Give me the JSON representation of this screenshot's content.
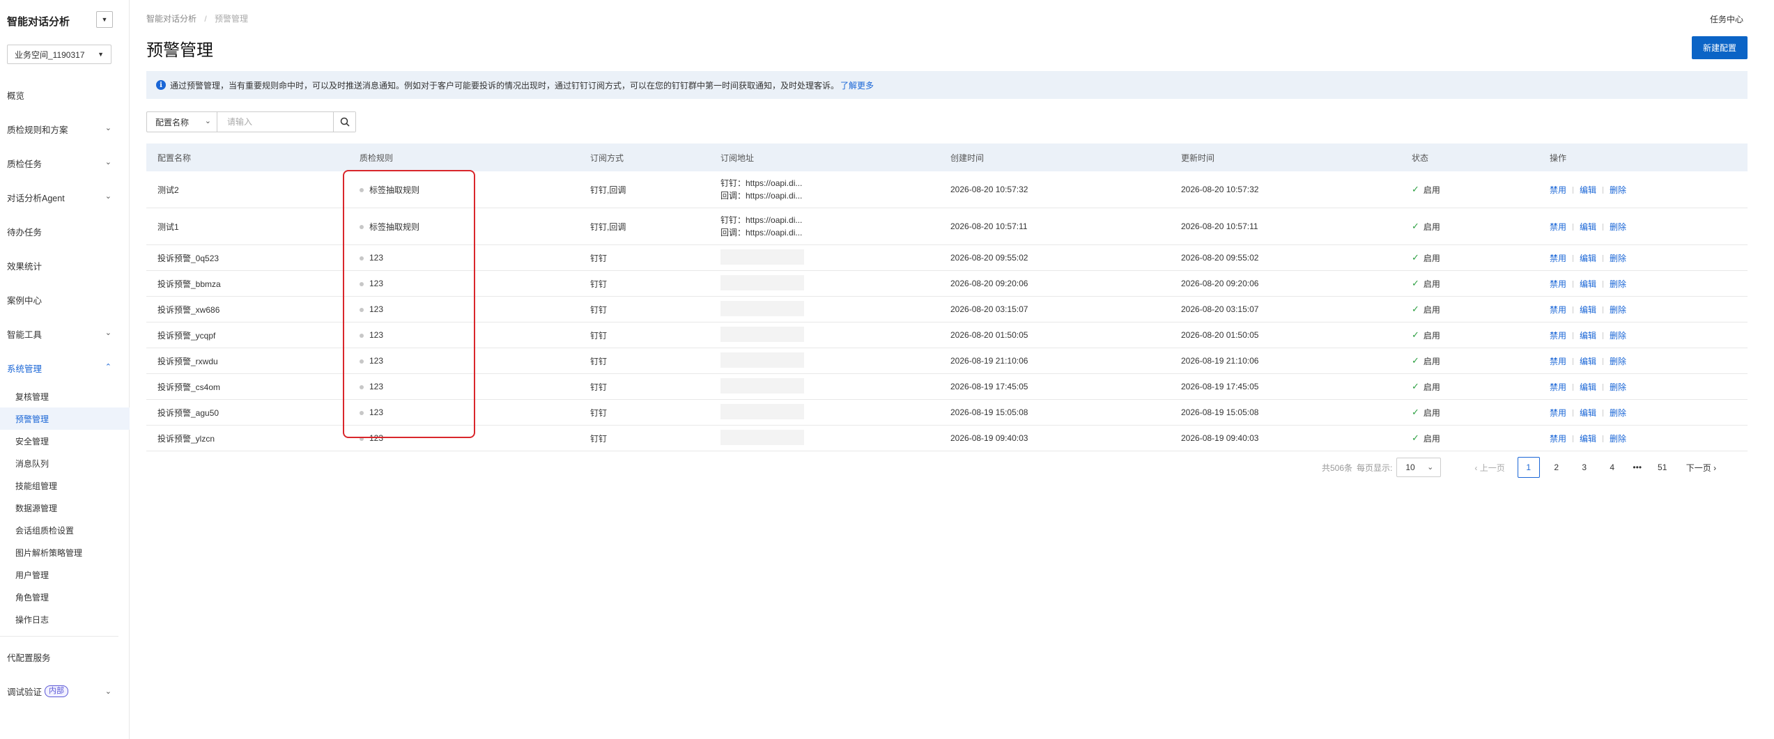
{
  "sidebar": {
    "brand": "智能对话分析",
    "workspace": "业务空间_1190317",
    "items": [
      {
        "label": "概览",
        "has_chevron": false
      },
      {
        "label": "质检规则和方案",
        "has_chevron": true
      },
      {
        "label": "质检任务",
        "has_chevron": true
      },
      {
        "label": "对话分析Agent",
        "has_chevron": true
      },
      {
        "label": "待办任务",
        "has_chevron": false
      },
      {
        "label": "效果统计",
        "has_chevron": false
      },
      {
        "label": "案例中心",
        "has_chevron": false
      },
      {
        "label": "智能工具",
        "has_chevron": true
      }
    ],
    "system": {
      "label": "系统管理",
      "subitems": [
        "复核管理",
        "预警管理",
        "安全管理",
        "消息队列",
        "技能组管理",
        "数据源管理",
        "会话组质检设置",
        "图片解析策略管理",
        "用户管理",
        "角色管理",
        "操作日志"
      ],
      "active": "预警管理"
    },
    "bottom": {
      "config_service": "代配置服务",
      "debug": "调试验证",
      "debug_badge": "内部"
    }
  },
  "header": {
    "breadcrumb": [
      "智能对话分析",
      "预警管理"
    ],
    "task_center": "任务中心",
    "title": "预警管理",
    "new_button": "新建配置"
  },
  "notice": {
    "text": "通过预警管理，当有重要规则命中时，可以及时推送消息通知。例如对于客户可能要投诉的情况出现时，通过钉钉订阅方式，可以在您的钉钉群中第一时间获取通知，及时处理客诉。",
    "link": "了解更多"
  },
  "filter": {
    "field": "配置名称",
    "placeholder": "请输入"
  },
  "table": {
    "columns": [
      "配置名称",
      "质检规则",
      "订阅方式",
      "订阅地址",
      "创建时间",
      "更新时间",
      "状态",
      "操作"
    ],
    "rows": [
      {
        "name": "测试2",
        "rule": "标签抽取规则",
        "method": "钉钉,回调",
        "addr": [
          "钉钉：https://oapi.di...",
          "回调：https://oapi.di..."
        ],
        "created": "2026-08-20 10:57:32",
        "updated": "2026-08-20 10:57:32",
        "status": "启用"
      },
      {
        "name": "测试1",
        "rule": "标签抽取规则",
        "method": "钉钉,回调",
        "addr": [
          "钉钉：https://oapi.di...",
          "回调：https://oapi.di..."
        ],
        "created": "2026-08-20 10:57:11",
        "updated": "2026-08-20 10:57:11",
        "status": "启用"
      },
      {
        "name": "投诉预警_0q523",
        "rule": "123",
        "method": "钉钉",
        "addr": [],
        "created": "2026-08-20 09:55:02",
        "updated": "2026-08-20 09:55:02",
        "status": "启用"
      },
      {
        "name": "投诉预警_bbmza",
        "rule": "123",
        "method": "钉钉",
        "addr": [],
        "created": "2026-08-20 09:20:06",
        "updated": "2026-08-20 09:20:06",
        "status": "启用"
      },
      {
        "name": "投诉预警_xw686",
        "rule": "123",
        "method": "钉钉",
        "addr": [],
        "created": "2026-08-20 03:15:07",
        "updated": "2026-08-20 03:15:07",
        "status": "启用"
      },
      {
        "name": "投诉预警_ycqpf",
        "rule": "123",
        "method": "钉钉",
        "addr": [],
        "created": "2026-08-20 01:50:05",
        "updated": "2026-08-20 01:50:05",
        "status": "启用"
      },
      {
        "name": "投诉预警_rxwdu",
        "rule": "123",
        "method": "钉钉",
        "addr": [],
        "created": "2026-08-19 21:10:06",
        "updated": "2026-08-19 21:10:06",
        "status": "启用"
      },
      {
        "name": "投诉预警_cs4om",
        "rule": "123",
        "method": "钉钉",
        "addr": [],
        "created": "2026-08-19 17:45:05",
        "updated": "2026-08-19 17:45:05",
        "status": "启用"
      },
      {
        "name": "投诉预警_agu50",
        "rule": "123",
        "method": "钉钉",
        "addr": [],
        "created": "2026-08-19 15:05:08",
        "updated": "2026-08-19 15:05:08",
        "status": "启用"
      },
      {
        "name": "投诉预警_ylzcn",
        "rule": "123",
        "method": "钉钉",
        "addr": [],
        "created": "2026-08-19 09:40:03",
        "updated": "2026-08-19 09:40:03",
        "status": "启用"
      }
    ],
    "actions": [
      "禁用",
      "编辑",
      "删除"
    ]
  },
  "pagination": {
    "total": "共506条",
    "per_page_label": "每页显示:",
    "per_page": "10",
    "prev": "上一页",
    "pages": [
      "1",
      "2",
      "3",
      "4"
    ],
    "ellipsis": "•••",
    "last": "51",
    "next": "下一页",
    "current": "1"
  },
  "colors": {
    "accent": "#0b64c6",
    "link": "#1a66d6",
    "success": "#2ea043",
    "highlight": "#d9262b"
  }
}
